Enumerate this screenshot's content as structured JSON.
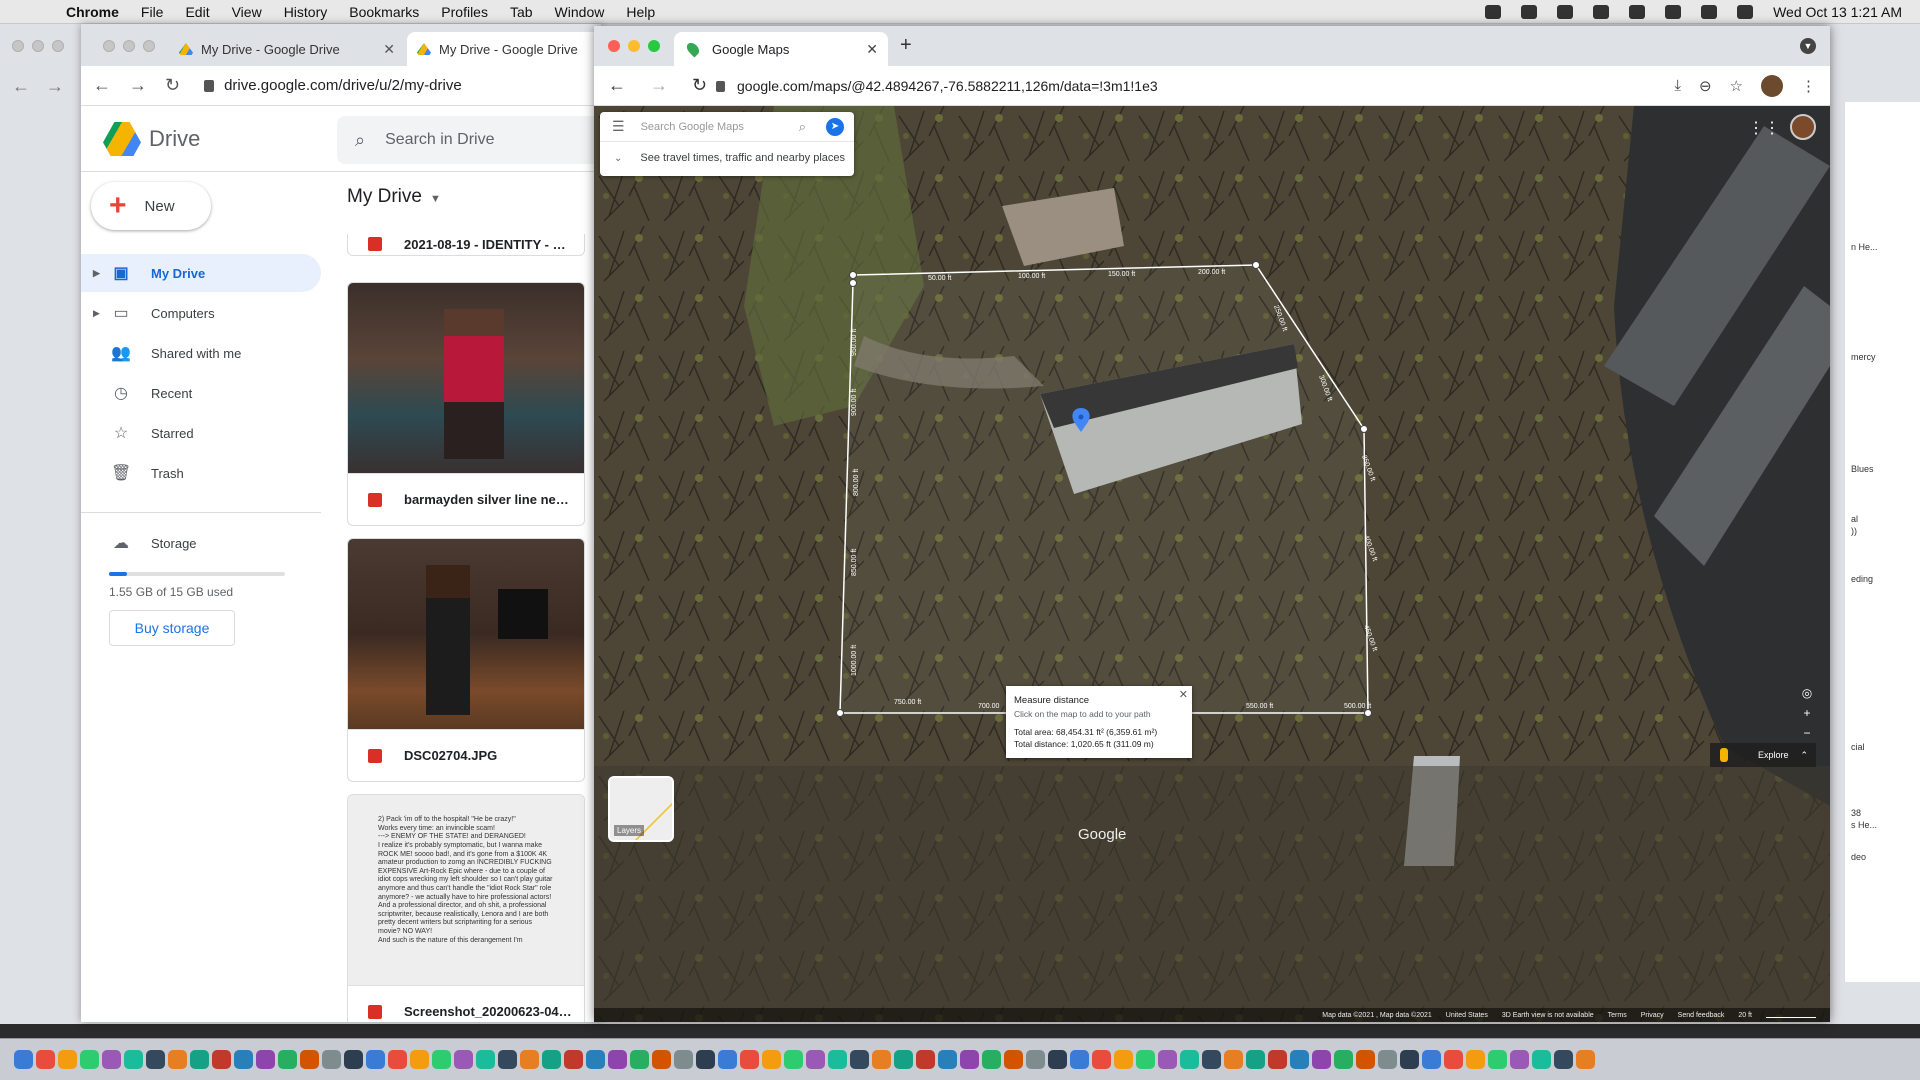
{
  "menubar": {
    "app": "Chrome",
    "items": [
      "File",
      "Edit",
      "View",
      "History",
      "Bookmarks",
      "Profiles",
      "Tab",
      "Window",
      "Help"
    ],
    "clock": "Wed Oct 13  1:21 AM"
  },
  "back_window": {
    "side_snippets": [
      "n He...",
      "mercy",
      "Blues",
      "al",
      "))",
      "eding",
      "cial",
      "38",
      "s He...",
      "deo"
    ]
  },
  "drive_window": {
    "tabs": [
      {
        "label": "My Drive - Google Drive"
      },
      {
        "label": "My Drive - Google Drive"
      }
    ],
    "url": "drive.google.com/drive/u/2/my-drive",
    "brand": "Drive",
    "search_placeholder": "Search in Drive",
    "new_label": "New",
    "nav": [
      {
        "label": "My Drive",
        "icon": "my-drive-icon"
      },
      {
        "label": "Computers",
        "icon": "computers-icon"
      },
      {
        "label": "Shared with me",
        "icon": "shared-icon"
      },
      {
        "label": "Recent",
        "icon": "clock-icon"
      },
      {
        "label": "Starred",
        "icon": "star-icon"
      },
      {
        "label": "Trash",
        "icon": "trash-icon"
      }
    ],
    "storage_label": "Storage",
    "storage_used_text": "1.55 GB of 15 GB used",
    "storage_fraction": 0.103,
    "buy_storage": "Buy storage",
    "main_title": "My Drive",
    "files": [
      {
        "name": "2021-08-19 - IDENTITY - Co..."
      },
      {
        "name": "barmayden silver line need..."
      },
      {
        "name": "DSC02704.JPG"
      },
      {
        "name": "Screenshot_20200623-043..."
      }
    ],
    "doc_preview_text": "2) Pack 'im off to the hospital! \"He be crazy!\"\nWorks every time: an invincible scam!\n---> ENEMY OF THE STATE! and DERANGED!\nI realize it's probably symptomatic, but I wanna make ROCK ME! soooo bad!, and it's gone from a $100K 4K amateur production to zomg an INCREDIBLY FUCKING EXPENSIVE Art-Rock Epic where - due to a couple of idiot cops wrecking my left shoulder so I can't play guitar anymore and thus can't handle the \"idiot Rock Star\" role anymore? - we actually have to hire professional actors! And a professional director, and oh shit, a professional scriptwriter, because realistically, Lenora and I are both pretty decent writers but scriptwriting for a serious movie? NO WAY!\nAnd such is the nature of this derangement I'm"
  },
  "maps_window": {
    "tab_label": "Google Maps",
    "url": "google.com/maps/@42.4894267,-76.5882211,126m/data=!3m1!1e3",
    "search_placeholder": "Search Google Maps",
    "travel_hint": "See travel times, traffic and nearby places",
    "measure": {
      "title": "Measure distance",
      "subtitle": "Click on the map to add to your path",
      "area": "Total area: 68,454.31 ft² (6,359.61 m²)",
      "distance": "Total distance: 1,020.65 ft (311.09 m)"
    },
    "path_labels_top": [
      "50.00 ft",
      "100.00 ft",
      "150.00 ft",
      "200.00 ft"
    ],
    "path_labels_right": [
      "250.00 ft",
      "300.00 ft",
      "350.00 ft",
      "400.00 ft",
      "450.00 ft"
    ],
    "path_labels_bottom": [
      "500.00 ft",
      "550.00 ft",
      "700.00",
      "750.00 ft"
    ],
    "path_labels_left": [
      "800.00 ft",
      "850.00 ft",
      "900.00 ft",
      "950.00 ft",
      "1000.00 ft"
    ],
    "layers_label": "Layers",
    "watermark": "Google",
    "explore_label": "Explore",
    "attribution": [
      "Map data ©2021 , Map data ©2021",
      "United States",
      "3D Earth view is not available",
      "Terms",
      "Privacy",
      "Send feedback",
      "20 ft"
    ]
  },
  "dock": {
    "count": 72
  }
}
